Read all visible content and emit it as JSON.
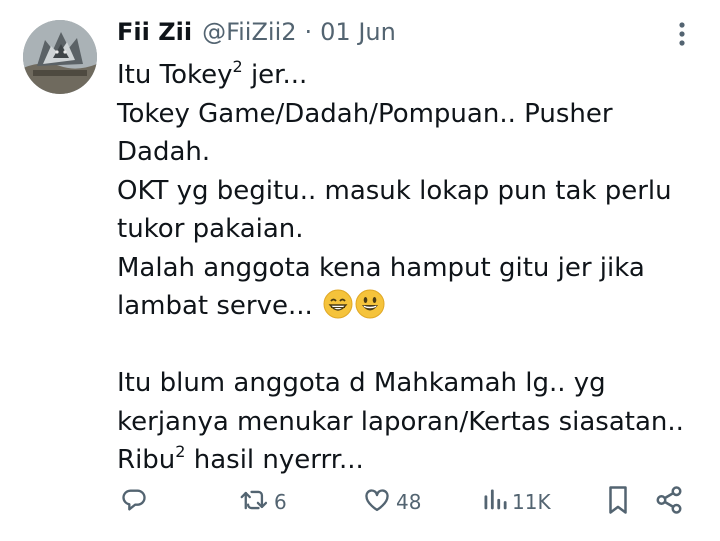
{
  "tweet": {
    "author_name": "Fii Zii",
    "handle": "@FiiZii2",
    "separator": "·",
    "date": "01 Jun",
    "more_icon": "more-vertical-icon",
    "body": {
      "line1_pre": "Itu Tokey",
      "line1_sup": "2",
      "line1_post": " jer...",
      "line2": "Tokey Game/Dadah/Pompuan.. Pusher",
      "line3": "Dadah.",
      "line4": "OKT yg begitu.. masuk lokap pun tak perlu",
      "line5": "tukor pakaian.",
      "line6": "Malah anggota kena hamput gitu jer jika",
      "line7": "lambat serve... ",
      "line7_emojis": [
        "grinning-teeth-emoji",
        "grinning-face-emoji"
      ],
      "line9": "Itu blum anggota d Mahkamah lg.. yg",
      "line10": "kerjanya menukar laporan/Kertas siasatan..",
      "line11_pre": "Ribu",
      "line11_sup": "2",
      "line11_post": " hasil nyerrr..."
    },
    "actions": {
      "reply_icon": "reply-icon",
      "retweet_icon": "retweet-icon",
      "retweet_count": "6",
      "like_icon": "heart-icon",
      "like_count": "48",
      "views_icon": "views-icon",
      "views_count": "11K",
      "bookmark_icon": "bookmark-icon",
      "share_icon": "share-icon"
    },
    "colors": {
      "text": "#0f1419",
      "secondary": "#536471",
      "background": "#ffffff",
      "emoji_yellow": "#f5c33b"
    }
  }
}
